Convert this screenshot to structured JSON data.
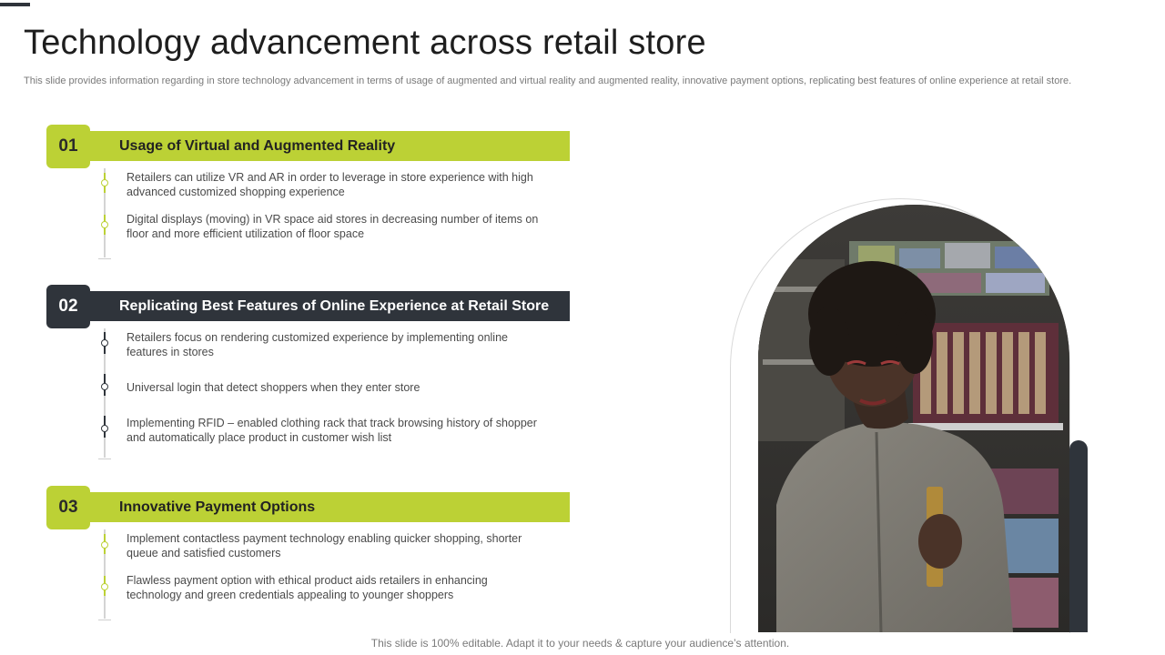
{
  "title": "Technology advancement across retail store",
  "subtitle": "This slide provides information regarding in store technology advancement in terms of usage of augmented and virtual reality and augmented reality, innovative payment options, replicating best features of online experience at retail store.",
  "sections": [
    {
      "number": "01",
      "heading": "Usage of Virtual and Augmented Reality",
      "bullets": [
        "Retailers can utilize VR and AR in order to leverage  in store experience with high advanced  customized shopping  experience",
        "Digital displays (moving)  in VR space aid stores in decreasing number of items on floor and more efficient utilization of floor space"
      ]
    },
    {
      "number": "02",
      "heading": "Replicating Best Features of Online Experience at Retail Store",
      "bullets": [
        "Retailers focus on rendering customized experience  by implementing online features in stores",
        "Universal  login that detect shoppers when they enter store",
        "Implementing RFID – enabled clothing rack that track browsing history of shopper and automatically place product in customer wish list"
      ]
    },
    {
      "number": "03",
      "heading": "Innovative Payment Options",
      "bullets": [
        "Implement  contactless payment technology enabling quicker shopping, shorter queue and satisfied customers",
        "Flawless payment option with ethical product aids retailers in enhancing technology and green  credentials appealing to younger shoppers"
      ]
    }
  ],
  "footer": "This slide is 100% editable. Adapt it to your needs & capture your audience’s attention.",
  "colors": {
    "accent": "#bcd135",
    "dark": "#2f343b"
  },
  "image": "woman-shopping-in-store-photo"
}
